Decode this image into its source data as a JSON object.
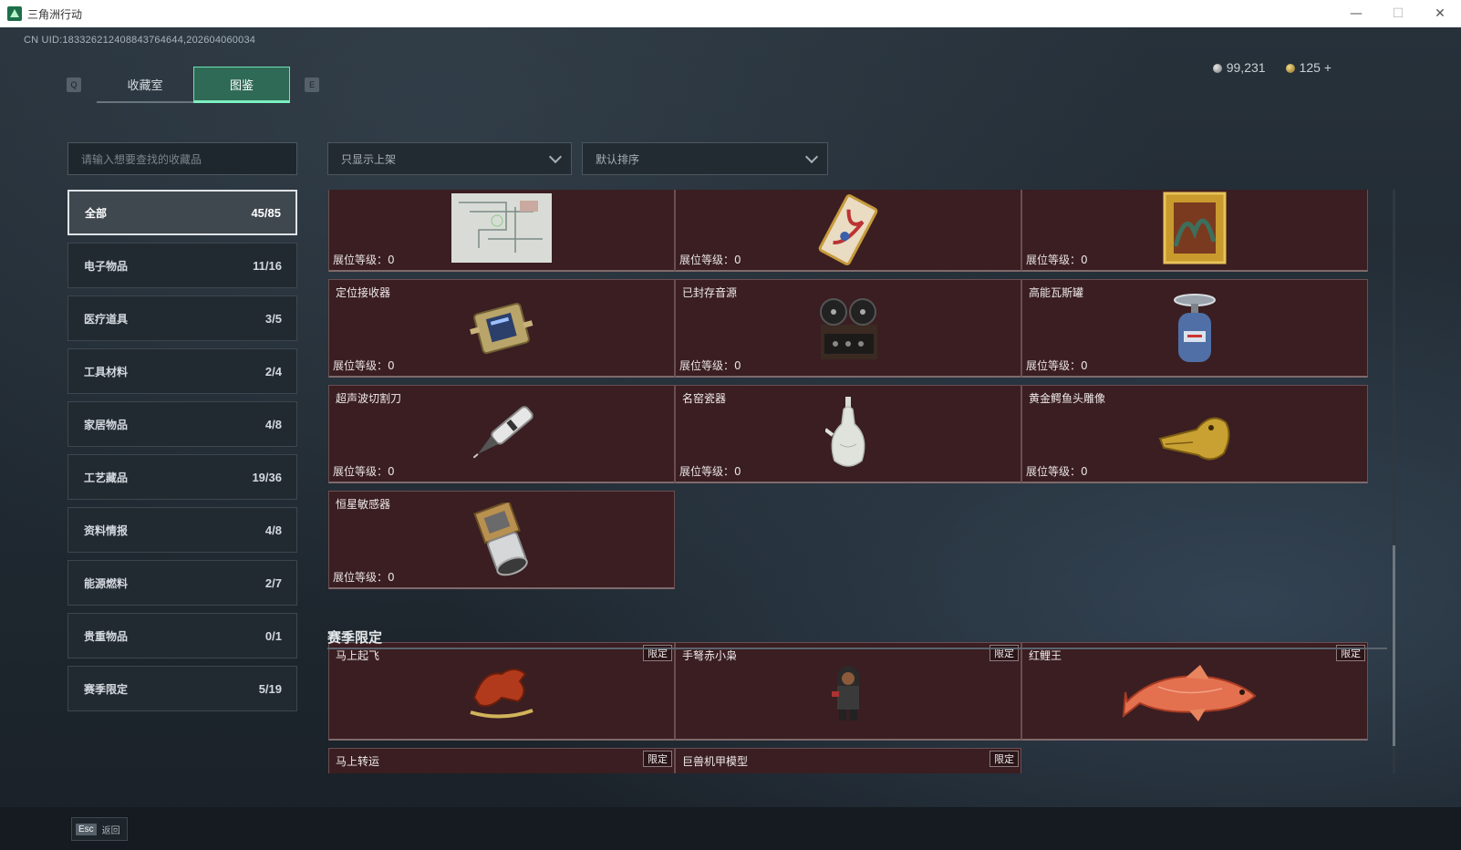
{
  "window": {
    "title": "三角洲行动",
    "minimize": "—",
    "maximize": "☐",
    "close": "✕"
  },
  "uid": "CN UID:183326212408843764644,202604060034",
  "hotkeys": {
    "prev_tab": "Q",
    "next_tab": "E"
  },
  "tabs": [
    {
      "label": "收藏室",
      "active": false
    },
    {
      "label": "图鉴",
      "active": true
    }
  ],
  "currency": {
    "silver": "99,231",
    "gold": "125",
    "add": "+"
  },
  "search": {
    "placeholder": "请输入想要查找的收藏品"
  },
  "filters": {
    "show": "只显示上架",
    "sort": "默认排序"
  },
  "categories": [
    {
      "label": "全部",
      "count": "45/85",
      "active": true
    },
    {
      "label": "电子物品",
      "count": "11/16"
    },
    {
      "label": "医疗道具",
      "count": "3/5"
    },
    {
      "label": "工具材料",
      "count": "2/4"
    },
    {
      "label": "家居物品",
      "count": "4/8"
    },
    {
      "label": "工艺藏品",
      "count": "19/36"
    },
    {
      "label": "资料情报",
      "count": "4/8"
    },
    {
      "label": "能源燃料",
      "count": "2/7"
    },
    {
      "label": "贵重物品",
      "count": "0/1"
    },
    {
      "label": "赛季限定",
      "count": "5/19"
    }
  ],
  "level_label": "展位等级：",
  "items": [
    {
      "name": "",
      "level": "0",
      "icon": "blueprint-map"
    },
    {
      "name": "",
      "level": "0",
      "icon": "ornate-card"
    },
    {
      "name": "",
      "level": "0",
      "icon": "framed-painting"
    },
    {
      "name": "定位接收器",
      "level": "0",
      "icon": "gps-receiver"
    },
    {
      "name": "已封存音源",
      "level": "0",
      "icon": "reel-to-reel-recorder"
    },
    {
      "name": "高能瓦斯罐",
      "level": "0",
      "icon": "gas-canister"
    },
    {
      "name": "超声波切割刀",
      "level": "0",
      "icon": "ultrasonic-cutter"
    },
    {
      "name": "名窑瓷器",
      "level": "0",
      "icon": "porcelain-vase"
    },
    {
      "name": "黄金鳄鱼头雕像",
      "level": "0",
      "icon": "golden-crocodile-head"
    },
    {
      "name": "恒星敏感器",
      "level": "0",
      "icon": "star-sensor"
    }
  ],
  "season_section": {
    "title": "赛季限定",
    "limited_label": "限定"
  },
  "season_items": [
    {
      "name": "马上起飞",
      "icon": "red-horse-statue"
    },
    {
      "name": "手弩赤小枭",
      "icon": "hooded-figure"
    },
    {
      "name": "红鲤王",
      "icon": "red-carp"
    },
    {
      "name": "马上转运",
      "icon": "partially-hidden"
    },
    {
      "name": "巨兽机甲模型",
      "icon": "partially-hidden"
    }
  ],
  "bottom": {
    "esc_key": "Esc",
    "back": "返回"
  }
}
